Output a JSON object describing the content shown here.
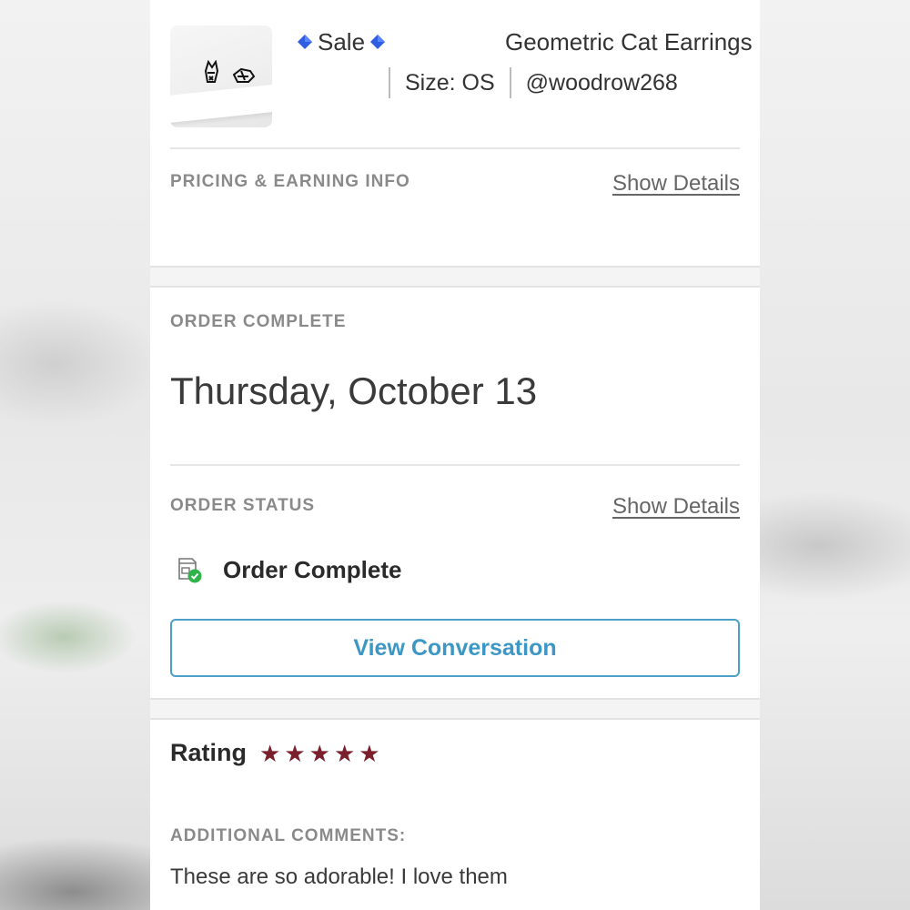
{
  "listing": {
    "badge_label": "Sale",
    "title": "Geometric Cat Earrings",
    "size_label": "Size: OS",
    "seller": "@woodrow268",
    "thumbnail_icon": "earrings-product-photo"
  },
  "pricing": {
    "heading": "PRICING & EARNING INFO",
    "link_label": "Show Details"
  },
  "order": {
    "heading": "ORDER COMPLETE",
    "date": "Thursday, October 13"
  },
  "status": {
    "heading": "ORDER STATUS",
    "link_label": "Show Details",
    "icon": "package-check-icon",
    "text": "Order Complete"
  },
  "actions": {
    "view_conversation": "View Conversation"
  },
  "rating": {
    "label": "Rating",
    "stars": 5,
    "max_stars": 5,
    "star_color": "#7a1f2b"
  },
  "comments": {
    "heading": "ADDITIONAL COMMENTS:",
    "text": "These are so adorable! I love them"
  },
  "colors": {
    "accent_blue": "#3d97c4",
    "status_green": "#2fb34a",
    "diamond_blue": "#2f5fe0"
  }
}
